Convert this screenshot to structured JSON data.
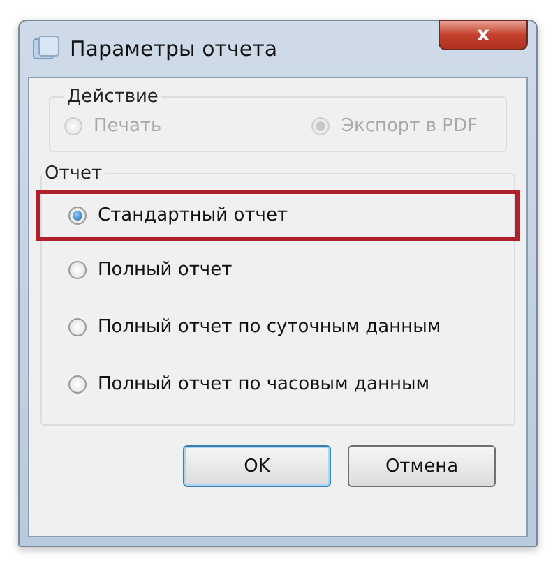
{
  "window": {
    "title": "Параметры отчета",
    "close_label": "x"
  },
  "action_group": {
    "title": "Действие",
    "disabled": true,
    "options": [
      {
        "label": "Печать",
        "selected": false
      },
      {
        "label": "Экспорт в PDF",
        "selected": true
      }
    ]
  },
  "report_group": {
    "title": "Отчет",
    "options": [
      {
        "label": "Стандартный отчет",
        "selected": true,
        "highlighted": true
      },
      {
        "label": "Полный отчет",
        "selected": false,
        "highlighted": false
      },
      {
        "label": "Полный отчет по суточным данным",
        "selected": false,
        "highlighted": false
      },
      {
        "label": "Полный отчет по часовым данным",
        "selected": false,
        "highlighted": false
      }
    ]
  },
  "buttons": [
    {
      "label": "OK",
      "default": true
    },
    {
      "label": "Отмена",
      "default": false
    }
  ]
}
